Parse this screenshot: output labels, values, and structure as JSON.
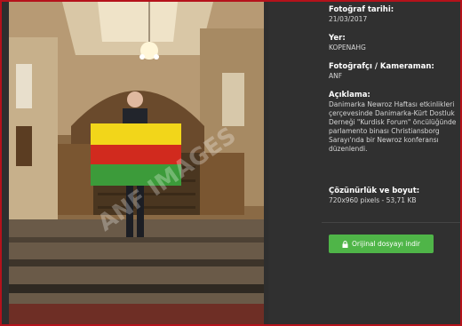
{
  "photo": {
    "watermark": "ANF IMAGES",
    "alt": ""
  },
  "details": {
    "date_label": "Fotoğraf tarihi:",
    "date_value": "21/03/2017",
    "place_label": "Yer:",
    "place_value": "KOPENAHG",
    "photographer_label": "Fotoğrafçı / Kameraman:",
    "photographer_value": "ANF",
    "description_label": "Açıklama:",
    "description_value": "Danimarka Newroz Haftası etkinlikleri çerçevesinde Danimarka-Kürt Dostluk Derneği \"Kurdisk Forum\" öncülüğünde parlamento binası Christiansborg Sarayı'nda bir Newroz konferansı düzenlendi.",
    "resolution_label": "Çözünürlük ve boyut:",
    "resolution_value": "720x960 pixels - 53,71 KB"
  },
  "download": {
    "label": "Orijinal dosyayı indir",
    "icon": "lock-icon"
  },
  "colors": {
    "frame": "#b5121b",
    "panel": "#303030",
    "button": "#4fb548"
  }
}
